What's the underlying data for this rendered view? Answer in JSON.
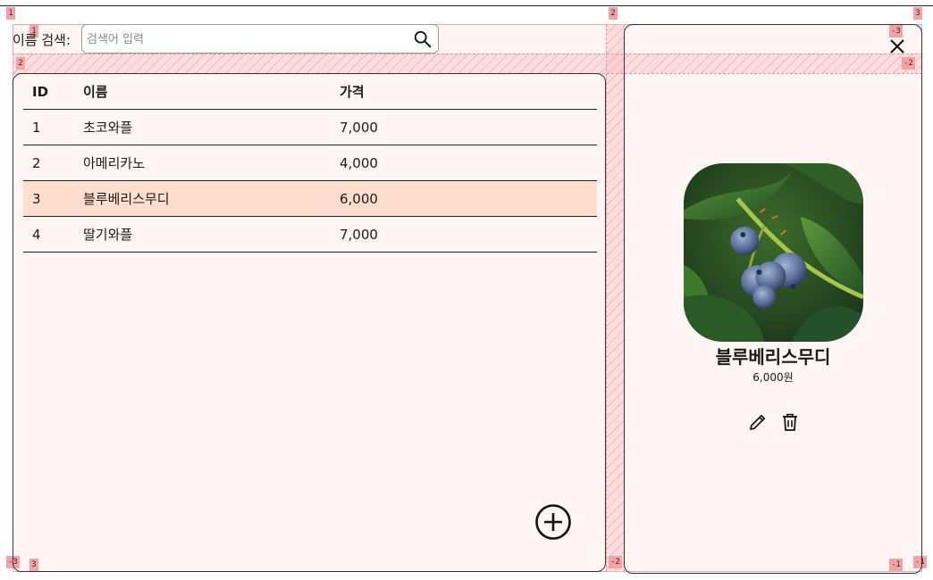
{
  "search": {
    "label": "이름 검색:",
    "placeholder": "검색어 입력",
    "value": ""
  },
  "table": {
    "headers": {
      "id": "ID",
      "name": "이름",
      "price": "가격"
    },
    "rows": [
      {
        "id": "1",
        "name": "초코와플",
        "price": "7,000"
      },
      {
        "id": "2",
        "name": "아메리카노",
        "price": "4,000"
      },
      {
        "id": "3",
        "name": "블루베리스무디",
        "price": "6,000",
        "selected": true
      },
      {
        "id": "4",
        "name": "딸기와플",
        "price": "7,000"
      }
    ]
  },
  "detail": {
    "name": "블루베리스무디",
    "price": "6,000원"
  },
  "grid_labels": [
    "1",
    "1",
    "2",
    "3",
    "2",
    "-2",
    "-3",
    "3",
    "-2",
    "-1",
    "-1",
    "-3"
  ],
  "icons": {
    "search": "search-icon",
    "add": "plus-circle-icon",
    "close": "close-icon",
    "edit": "pencil-icon",
    "delete": "trash-icon"
  },
  "colors": {
    "grid_background": "#fff5f5",
    "grid_label": "#f1a3a8",
    "selected_row": "#ffdecf",
    "border": "#333333"
  }
}
